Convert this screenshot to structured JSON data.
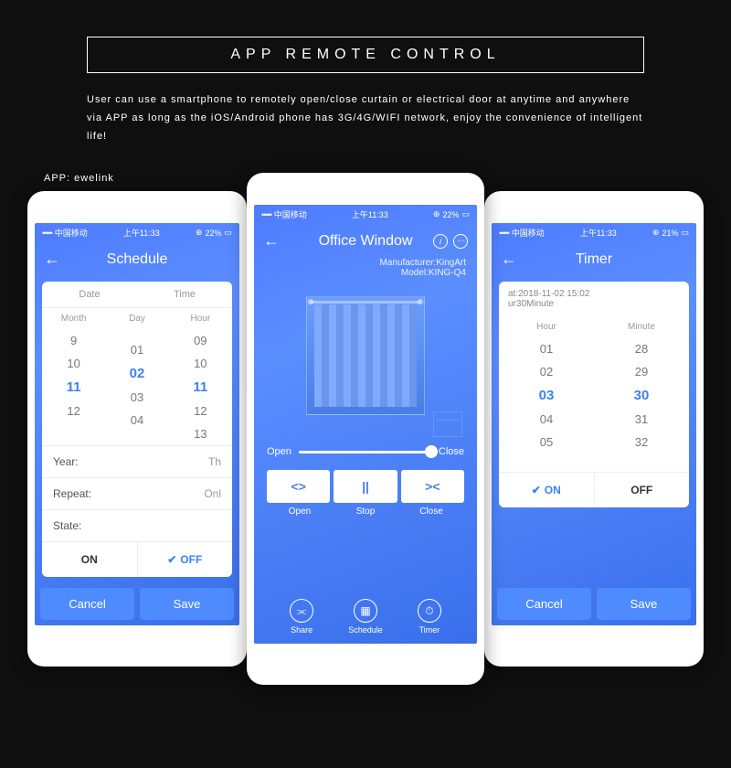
{
  "header": {
    "title": "APP REMOTE CONTROL"
  },
  "description": "User can use a smartphone to remotely open/close curtain or electrical door at anytime and anywhere via APP as long as the iOS/Android phone has 3G/4G/WIFI network, enjoy the convenience of intelligent life!",
  "app_label": "APP: ewelink",
  "status": {
    "carrier": "中国移动",
    "time": "上午11:33",
    "battery_left": "22%",
    "battery_right": "21%"
  },
  "schedule": {
    "title": "Schedule",
    "tabs": {
      "date": "Date",
      "time": "Time"
    },
    "cols": {
      "month": "Month",
      "day": "Day",
      "hour": "Hour"
    },
    "picker": {
      "month": [
        "9",
        "10",
        "11",
        "12",
        ""
      ],
      "day": [
        "",
        "01",
        "02",
        "03",
        "04"
      ],
      "hour": [
        "09",
        "10",
        "11",
        "12",
        "13"
      ],
      "sel_idx": 2
    },
    "rows": {
      "year_l": "Year:",
      "year_v": "Th",
      "repeat_l": "Repeat:",
      "repeat_v": "Onl",
      "state_l": "State:"
    },
    "on": "ON",
    "off": "OFF",
    "cancel": "Cancel",
    "save": "Save"
  },
  "device": {
    "title": "Office Window",
    "manufacturer": "Manufacturer:KingArt",
    "model": "Model:KING-Q4",
    "open": "Open",
    "close": "Close",
    "stop": "Stop",
    "footer": {
      "share": "Share",
      "schedule": "Schedule",
      "timer": "Timer"
    }
  },
  "timer": {
    "title": "Timer",
    "at": "at:2018-11-02 15:02",
    "dur": "ur30Minute",
    "cols": {
      "hour": "Hour",
      "minute": "Minute"
    },
    "picker": {
      "hour": [
        "01",
        "02",
        "03",
        "04",
        "05"
      ],
      "minute": [
        "28",
        "29",
        "30",
        "31",
        "32"
      ],
      "sel_idx": 2
    },
    "on": "ON",
    "off": "OFF",
    "cancel": "Cancel",
    "save": "Save"
  }
}
